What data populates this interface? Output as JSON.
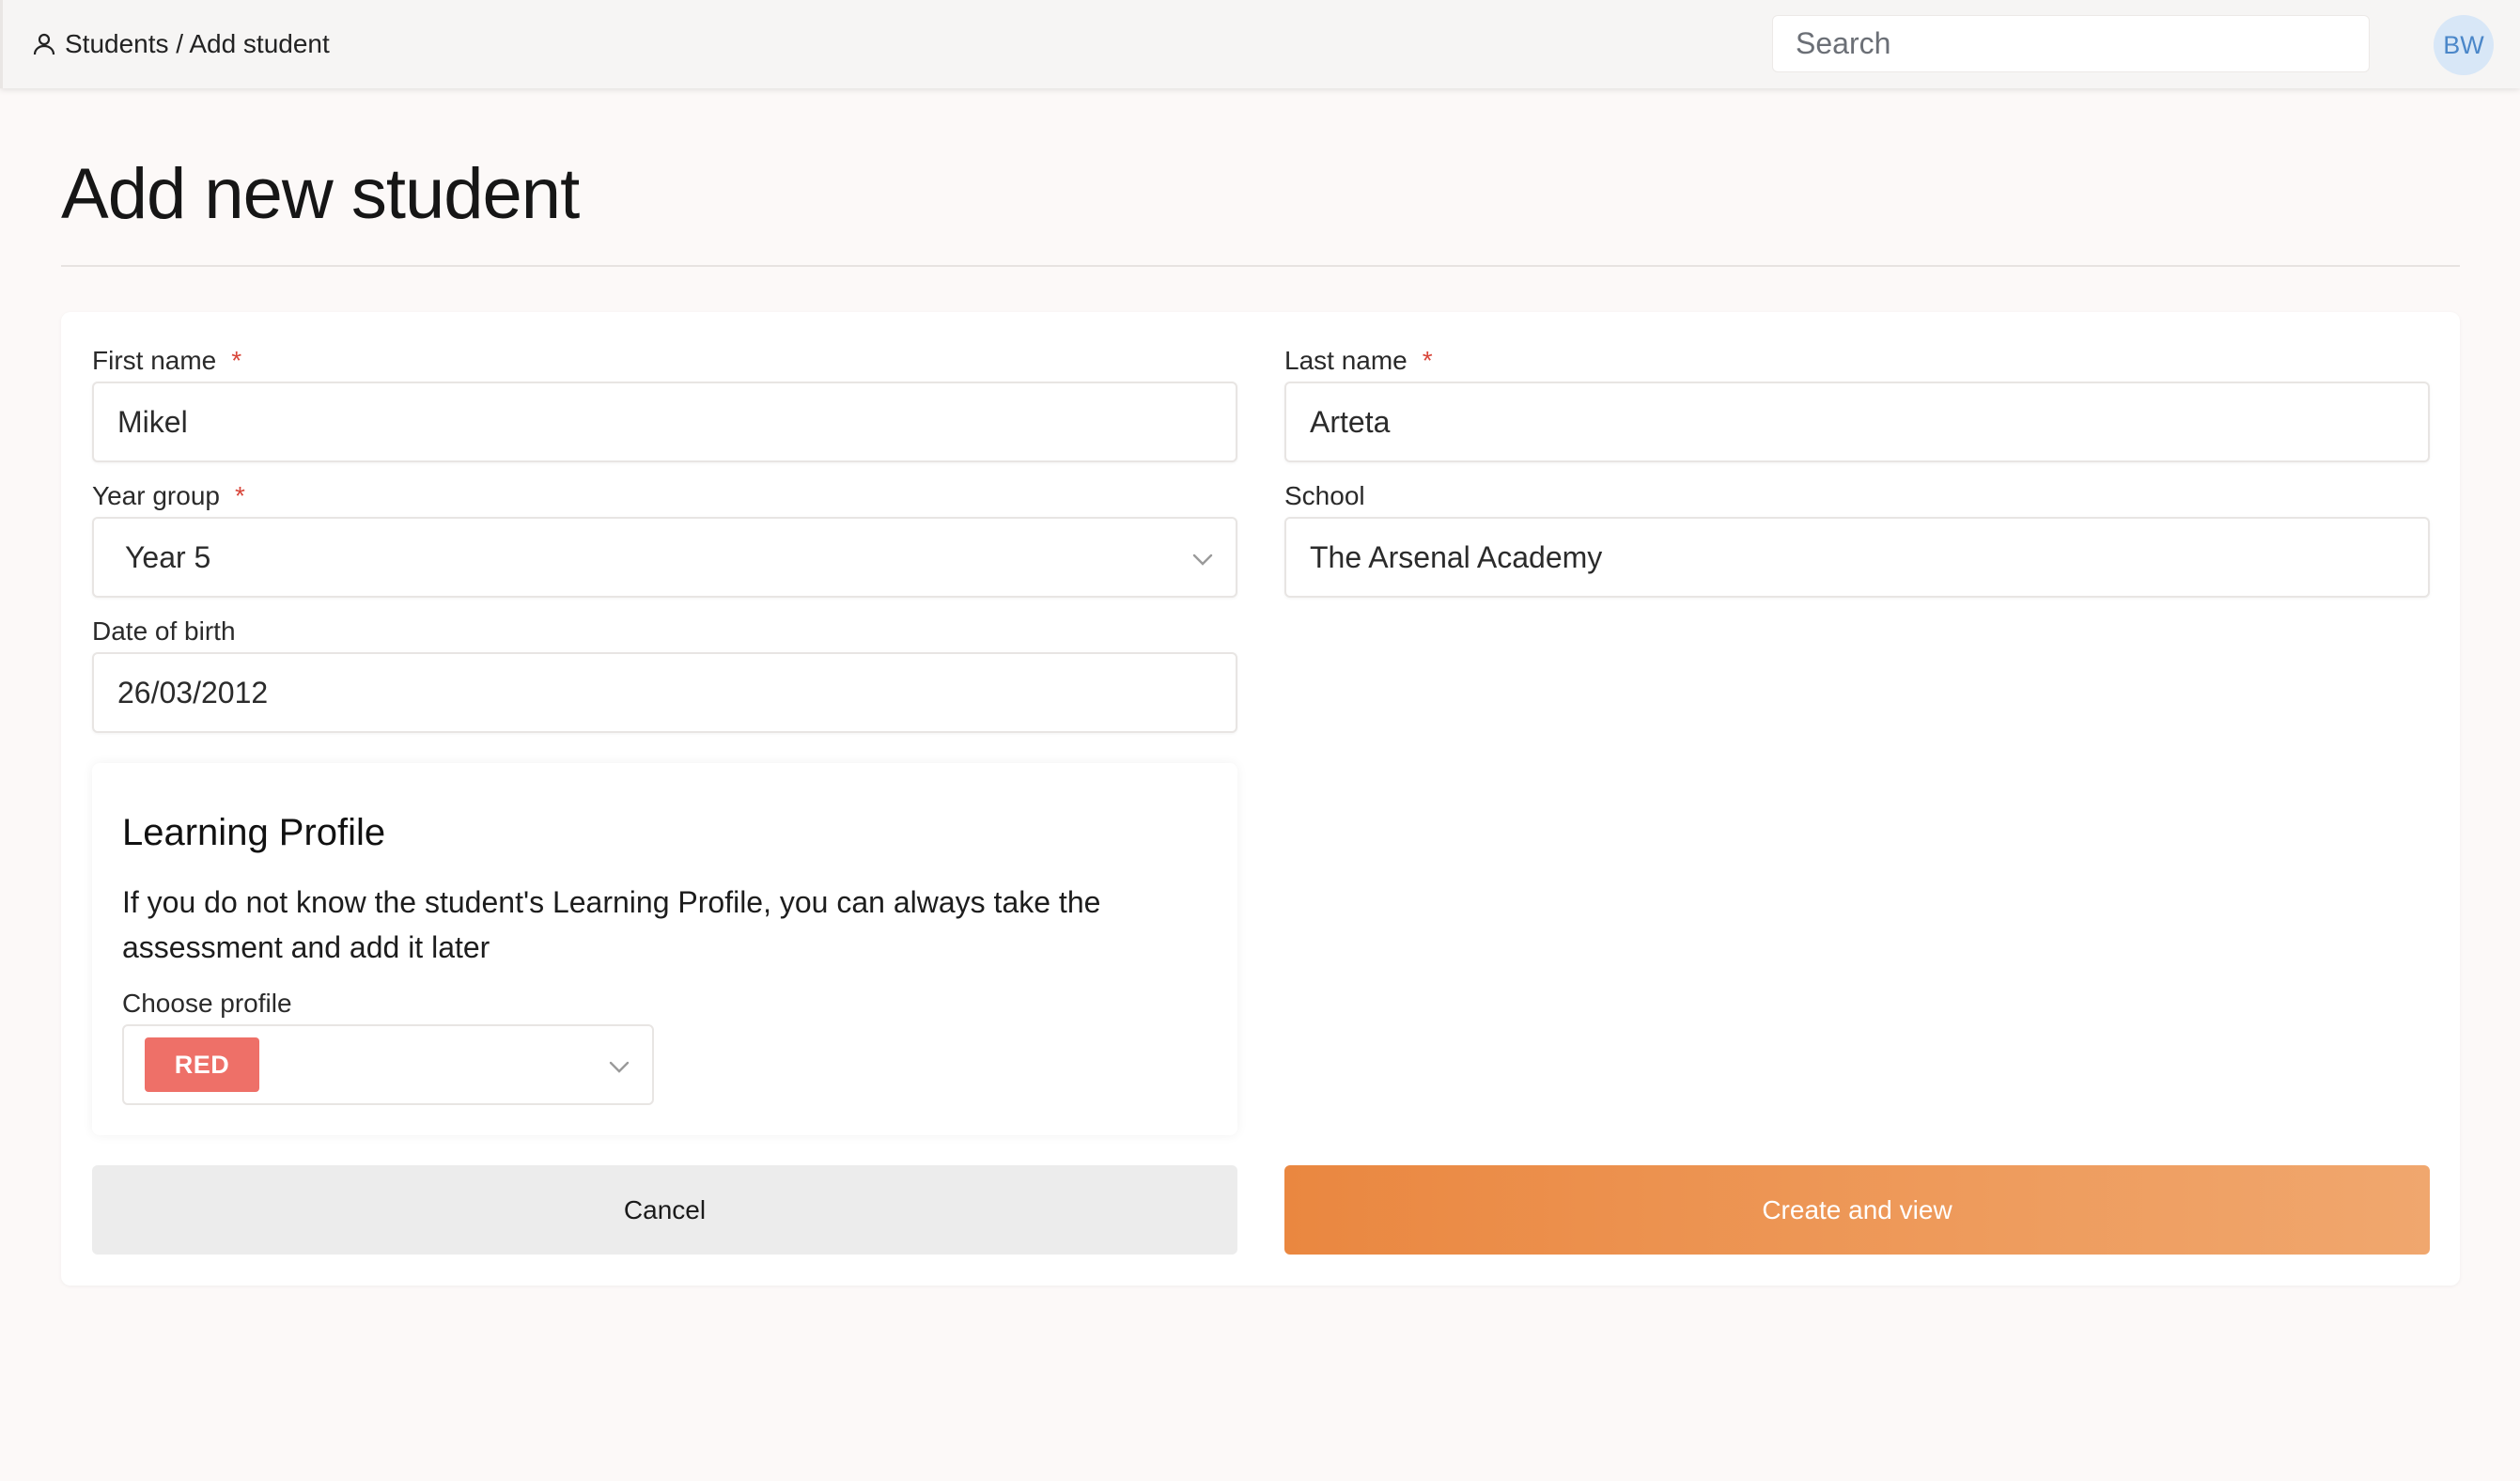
{
  "header": {
    "breadcrumb": "Students / Add student",
    "breadcrumb_icon": "user-icon",
    "search_placeholder": "Search",
    "avatar_initials": "BW"
  },
  "page": {
    "title": "Add new student"
  },
  "form": {
    "first_name": {
      "label": "First name",
      "required_mark": "*",
      "value": "Mikel"
    },
    "last_name": {
      "label": "Last name",
      "required_mark": "*",
      "value": "Arteta"
    },
    "year_group": {
      "label": "Year group",
      "required_mark": "*",
      "value": "Year 5"
    },
    "school": {
      "label": "School",
      "value": "The Arsenal Academy"
    },
    "date_of_birth": {
      "label": "Date of birth",
      "value": "26/03/2012"
    }
  },
  "learning_profile": {
    "title": "Learning Profile",
    "description": "If you do not know the student's Learning Profile, you can always take the assessment and add it later",
    "choose_label": "Choose profile",
    "selected": "RED",
    "selected_color": "#ee7068"
  },
  "actions": {
    "cancel_label": "Cancel",
    "create_label": "Create and view",
    "create_color": "#ea8740"
  }
}
